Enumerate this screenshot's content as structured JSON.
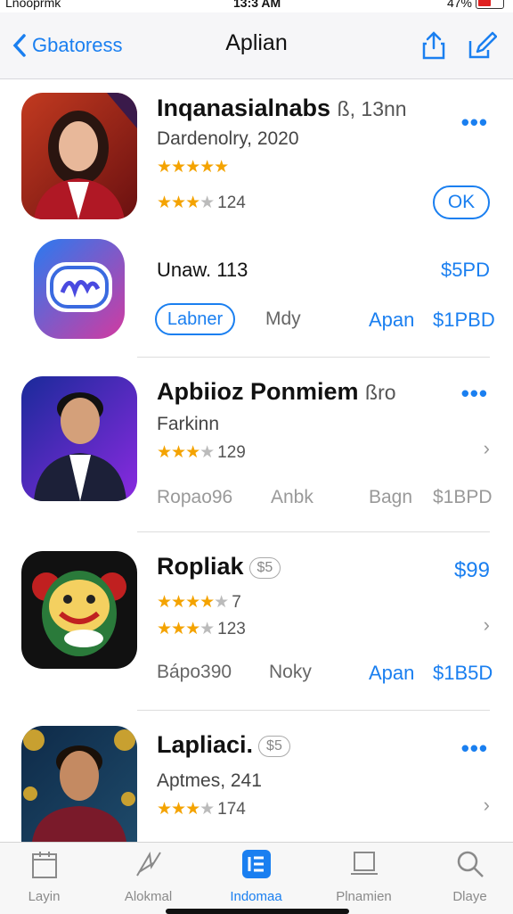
{
  "status": {
    "carrier": "Lnooprmk",
    "time": "13:3 AM",
    "battery": "47%"
  },
  "nav": {
    "back_label": "Gbatoress",
    "title": "Aplian"
  },
  "apps": [
    {
      "title": "Inqanasialnabs",
      "title_suffix": "ß, 13nn",
      "subtitle": "Dardenolry, 2020",
      "stars_top": "★★★★★",
      "rating": "124",
      "action": "OK"
    },
    {
      "title": "Unaw. 113",
      "price": "$5PD",
      "chip": "Labner",
      "meta": "Mdy",
      "link": "Apan",
      "link_price": "$1PBD"
    },
    {
      "title": "Apbiioz Ponmiem",
      "title_suffix": "ßro",
      "subtitle": "Farkinn",
      "rating": "129",
      "meta1": "Ropao96",
      "meta2": "Anbk",
      "link": "Bagn",
      "link_price": "$1BPD"
    },
    {
      "title": "Ropliak",
      "badge": "$5",
      "price": "$99",
      "sub_rating": "7",
      "rating": "123",
      "meta1": "Bápo390",
      "meta2": "Noky",
      "link": "Apan",
      "link_price": "$1B5D"
    },
    {
      "title": "Lapliaci.",
      "badge": "$5",
      "subtitle": "Aptmes, 241",
      "rating": "174"
    }
  ],
  "tabs": [
    {
      "label": "Layin",
      "icon": "calendar-icon"
    },
    {
      "label": "Alokmal",
      "icon": "compass-icon"
    },
    {
      "label": "Indomaa",
      "icon": "list-icon"
    },
    {
      "label": "Plnamien",
      "icon": "monitor-icon"
    },
    {
      "label": "Dlaye",
      "icon": "search-icon"
    }
  ],
  "colors": {
    "accent": "#1a7ff0",
    "star": "#f4a300"
  }
}
